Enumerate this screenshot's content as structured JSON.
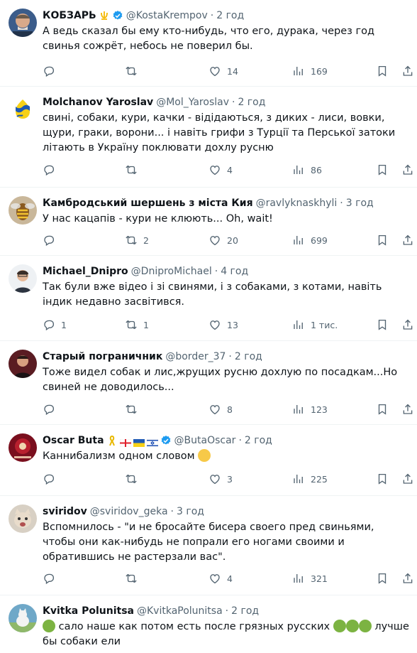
{
  "tweets": [
    {
      "name": "КОБЗАРЬ",
      "handle": "@KostaKrempov",
      "sep": "·",
      "time": "2 год",
      "text": "А ведь сказал бы ему кто-нибудь, что его, дурака, через год свинья сожрёт, небось не поверил бы.",
      "replies": "",
      "retweets": "",
      "likes": "14",
      "views": "169"
    },
    {
      "name": "Molchanov Yaroslav",
      "handle": "@Mol_Yaroslav",
      "sep": "·",
      "time": "2 год",
      "text": "свині, собаки, кури, качки - відідаються, з диких  - лиси, вовки, щури, граки, ворони... і навіть грифи з Турції та Перської затоки літають в Україну поклювати дохлу русню",
      "replies": "",
      "retweets": "",
      "likes": "4",
      "views": "86"
    },
    {
      "name": "Камбродський шершень з міста Кия",
      "handle": "@ravlyknaskhyli",
      "sep": "·",
      "time": "3 год",
      "text": "У нас кацапів - кури не клюють... Oh, wait!",
      "replies": "",
      "retweets": "2",
      "likes": "20",
      "views": "699"
    },
    {
      "name": "Michael_Dnipro",
      "handle": "@DniproMichael",
      "sep": "·",
      "time": "4 год",
      "text": "Так були вже відео і зі свинями, і з собаками, з котами, навіть індик недавно засвітився.",
      "replies": "1",
      "retweets": "1",
      "likes": "13",
      "views": "1 тис."
    },
    {
      "name": "Старый пограничник",
      "handle": "@border_37",
      "sep": "·",
      "time": "2 год",
      "text": "Тоже видел собак и лис,жрущих русню дохлую по посадкам...Но свиней не доводилось...",
      "replies": "",
      "retweets": "",
      "likes": "8",
      "views": "123"
    },
    {
      "name": "Oscar Buta",
      "handle": "@ButaOscar",
      "sep": "·",
      "time": "2 год",
      "text": "Каннибализм одном словом",
      "replies": "",
      "retweets": "",
      "likes": "3",
      "views": "225"
    },
    {
      "name": "sviridov",
      "handle": "@sviridov_geka",
      "sep": "·",
      "time": "3 год",
      "text": "Вспомнилось - \"и не бросайте бисера своего пред свиньями, чтобы они как-нибудь не попрали его ногами своими и обратившись не растерзали вас\".",
      "replies": "",
      "retweets": "",
      "likes": "4",
      "views": "321"
    },
    {
      "name": "Kvitka Polunitsa",
      "handle": "@KvitkaPolunitsa",
      "sep": "·",
      "time": "2 год",
      "text_a": "сало  наше  как  потом  есть  после грязных русских",
      "text_b": "лучше бы собаки  ели"
    }
  ],
  "colors": {
    "accent": "#1d9bf0",
    "muted": "#536471",
    "text": "#0f1419",
    "divider": "#eff3f4"
  },
  "icons": [
    "verified-badge-icon",
    "reply-icon",
    "retweet-icon",
    "like-icon",
    "views-icon",
    "bookmark-icon",
    "share-icon"
  ]
}
